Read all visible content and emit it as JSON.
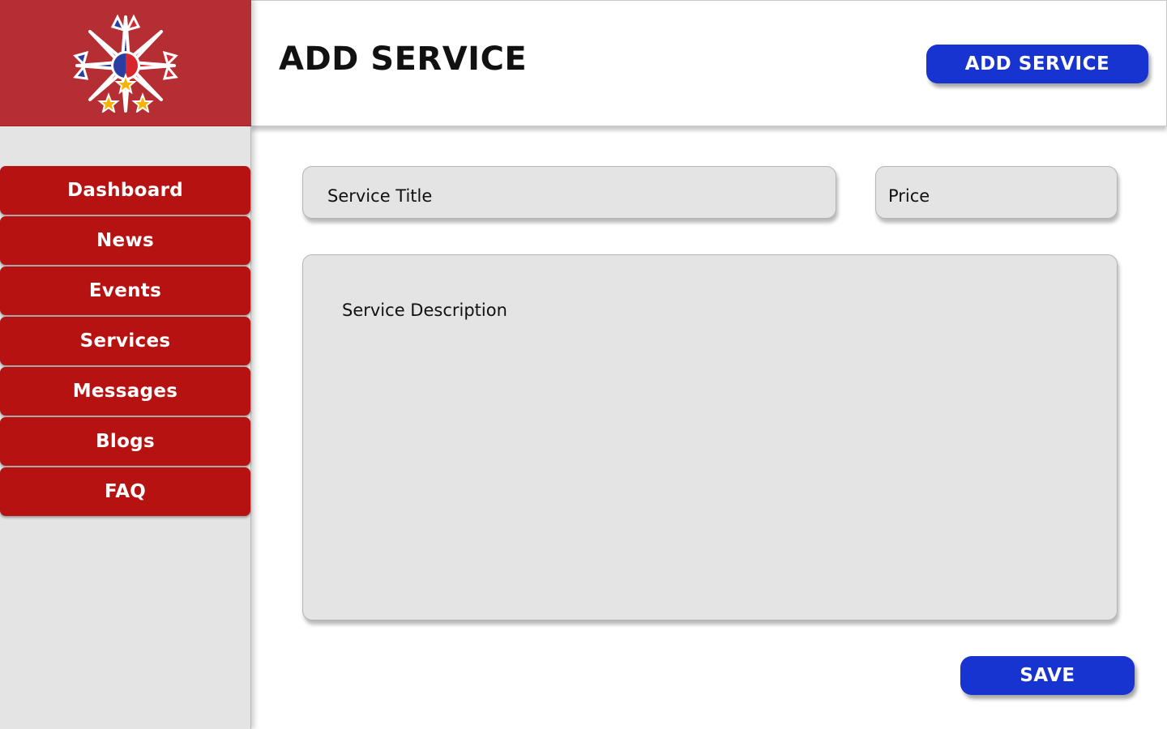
{
  "logo": {
    "icon": "philippine-sun-and-stars-logo",
    "colors": {
      "background": "#b42e33",
      "blue": "#2b3da3",
      "red": "#d8272c",
      "star": "#f5b400"
    }
  },
  "sidebar": {
    "items": [
      {
        "label": "Dashboard"
      },
      {
        "label": "News"
      },
      {
        "label": "Events"
      },
      {
        "label": "Services"
      },
      {
        "label": "Messages"
      },
      {
        "label": "Blogs"
      },
      {
        "label": "FAQ"
      }
    ]
  },
  "header": {
    "title": "ADD SERVICE",
    "add_button_label": "ADD SERVICE"
  },
  "form": {
    "service_title_placeholder": "Service Title",
    "price_placeholder": "Price",
    "description_placeholder": "Service Description",
    "save_label": "SAVE"
  },
  "colors": {
    "nav_item": "#b71212",
    "primary_button": "#1733d0",
    "sidebar_bg": "#e4e4e4",
    "field_bg": "#e4e4e4"
  }
}
